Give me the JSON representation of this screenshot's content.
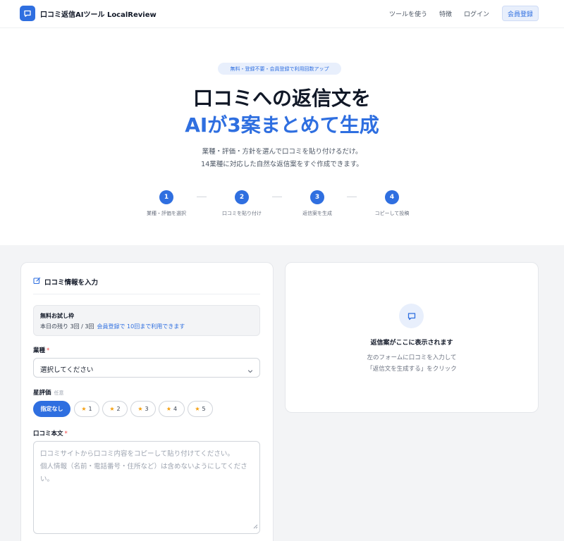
{
  "header": {
    "logo_icon": "chat-bubble-icon",
    "app_name": "口コミ返信AIツール LocalReview",
    "nav": [
      "ツールを使う",
      "特徴",
      "ログイン"
    ],
    "signup_label": "会員登録"
  },
  "hero": {
    "badge": "無料・登録不要・会員登録で利用回数アップ",
    "title_line1": "口コミへの返信文を",
    "title_line2": "AIが3案まとめて生成",
    "desc_line1": "業種・評価・方針を選んで口コミを貼り付けるだけ。",
    "desc_line2": "14業種に対応した自然な返信案をすぐ作成できます。",
    "steps": [
      {
        "num": "1",
        "label": "業種・評価を選択"
      },
      {
        "num": "2",
        "label": "口コミを貼り付け"
      },
      {
        "num": "3",
        "label": "返信案を生成"
      },
      {
        "num": "4",
        "label": "コピーして投稿"
      }
    ]
  },
  "form": {
    "title": "口コミ情報を入力",
    "title_icon": "edit-icon",
    "trial": {
      "title": "無料お試し枠",
      "remaining": "本日の残り 3回 / 3回",
      "link": "会員登録で 10回まで利用できます"
    },
    "industry_label": "業種",
    "required_mark": "*",
    "industry_select": "選択してください",
    "rating_label": "星評価",
    "rating_optional": "任意",
    "rating_options": [
      "指定なし",
      "1",
      "2",
      "3",
      "4",
      "5"
    ],
    "rating_selected": "指定なし",
    "review_label": "口コミ本文",
    "review_placeholder": "口コミサイトから口コミ内容をコピーして貼り付けてください。\n個人情報（名前・電話番号・住所など）は含めないようにしてください。"
  },
  "result": {
    "icon": "chat-bubble-icon",
    "title": "返信案がここに表示されます",
    "desc_line1": "左のフォームに口コミを入力して",
    "desc_line2": "「返信文を生成する」をクリック"
  },
  "colors": {
    "accent": "#2f6fe0",
    "accent_light": "#e8effc",
    "star": "#f59e0b",
    "required": "#ef4444"
  }
}
